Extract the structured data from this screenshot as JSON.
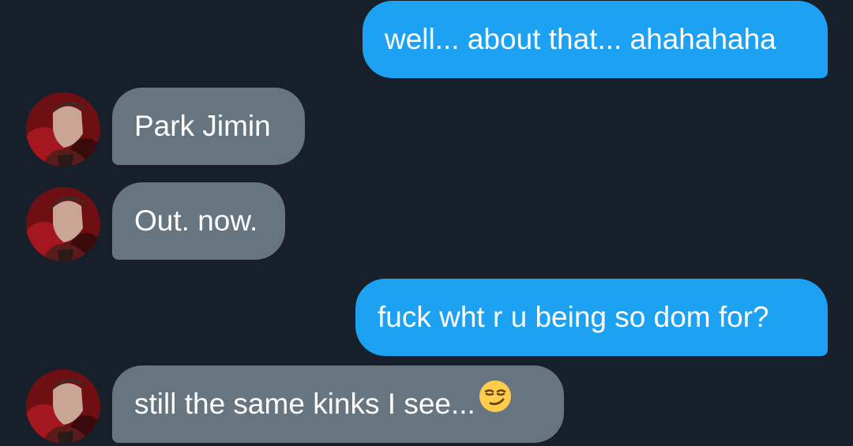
{
  "colors": {
    "background": "#17202a",
    "outgoing_bubble": "#1da1f2",
    "incoming_bubble": "#66757f",
    "text": "#ffffff"
  },
  "messages": [
    {
      "direction": "outgoing",
      "text": "well... about that... ahahahaha"
    },
    {
      "direction": "incoming",
      "text": "Park Jimin",
      "avatar": "contact-avatar-photo"
    },
    {
      "direction": "incoming",
      "text": "Out. now.",
      "avatar": "contact-avatar-photo"
    },
    {
      "direction": "outgoing",
      "text": "fuck wht r u being so dom for?"
    },
    {
      "direction": "incoming",
      "text": "still the same kinks I see...",
      "emoji": "smirking-face-emoji",
      "avatar": "contact-avatar-photo"
    }
  ]
}
